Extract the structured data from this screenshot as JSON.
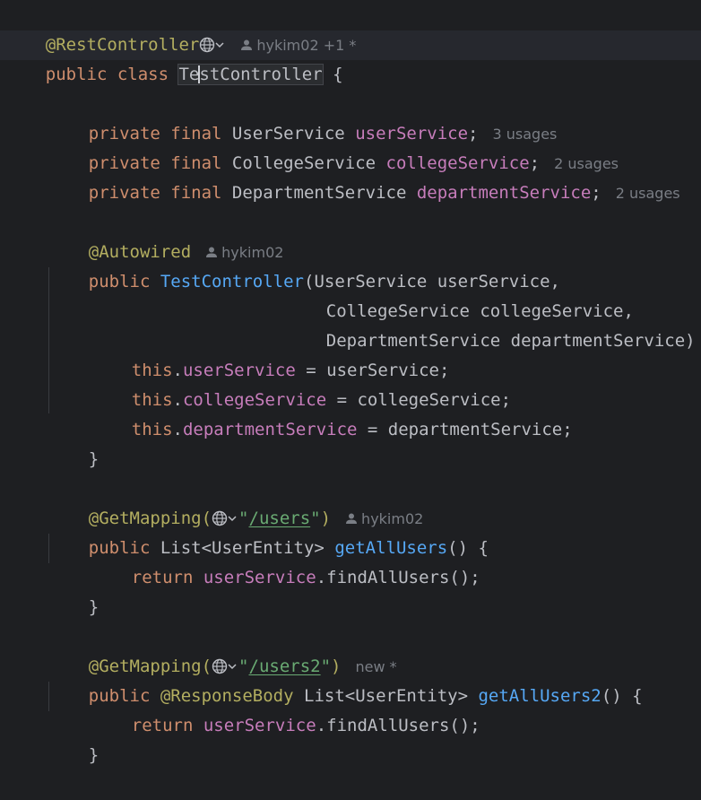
{
  "code": {
    "l1": {
      "ann": "@RestController",
      "author": "hykim02",
      "extra": "+1 *"
    },
    "l2": {
      "kw": "public class ",
      "name_a": "Te",
      "name_b": "stController",
      "brace": " {"
    },
    "l4": {
      "kw": "private final ",
      "type": "UserService ",
      "field": "userService",
      "semi": ";",
      "usages": "3 usages"
    },
    "l5": {
      "kw": "private final ",
      "type": "CollegeService ",
      "field": "collegeService",
      "semi": ";",
      "usages": "2 usages"
    },
    "l6": {
      "kw": "private final ",
      "type": "DepartmentService ",
      "field": "departmentService",
      "semi": ";",
      "usages": "2 usages"
    },
    "l8": {
      "ann": "@Autowired",
      "author": "hykim02"
    },
    "l9": {
      "kw": "public ",
      "fn": "TestController",
      "rest": "(UserService userService,"
    },
    "l10": {
      "rest": "CollegeService collegeService,"
    },
    "l11": {
      "rest": "DepartmentService departmentService) {"
    },
    "l12": {
      "kw": "this",
      "dot": ".",
      "field": "userService",
      "rest": " = userService;"
    },
    "l13": {
      "kw": "this",
      "dot": ".",
      "field": "collegeService",
      "rest": " = collegeService;"
    },
    "l14": {
      "kw": "this",
      "dot": ".",
      "field": "departmentService",
      "rest": " = departmentService;"
    },
    "l15": {
      "brace": "}"
    },
    "l17": {
      "ann": "@GetMapping(",
      "q1": "\"",
      "path": "/users",
      "q2": "\"",
      "close": ")",
      "author": "hykim02"
    },
    "l18": {
      "kw": "public ",
      "type": "List<UserEntity> ",
      "fn": "getAllUsers",
      "rest": "() {"
    },
    "l19": {
      "kw": "return ",
      "field": "userService",
      "rest": ".findAllUsers();"
    },
    "l20": {
      "brace": "}"
    },
    "l22": {
      "ann": "@GetMapping(",
      "q1": "\"",
      "path": "/users2",
      "q2": "\"",
      "close": ")",
      "hint": "new *"
    },
    "l23": {
      "kw": "public ",
      "ann": "@ResponseBody",
      "type": " List<UserEntity> ",
      "fn": "getAllUsers2",
      "rest": "() {"
    },
    "l24": {
      "kw": "return ",
      "field": "userService",
      "rest": ".findAllUsers();"
    },
    "l25": {
      "brace": "}"
    }
  },
  "colors": {
    "background": "#1e1f22",
    "keyword": "#cf8e6d",
    "annotation": "#b3ae60",
    "function": "#56a8f5",
    "field": "#c77dbb",
    "string": "#6aab73",
    "hint": "#7a7e85"
  },
  "icons": [
    "globe-icon",
    "chevron-down-icon",
    "person-icon"
  ]
}
